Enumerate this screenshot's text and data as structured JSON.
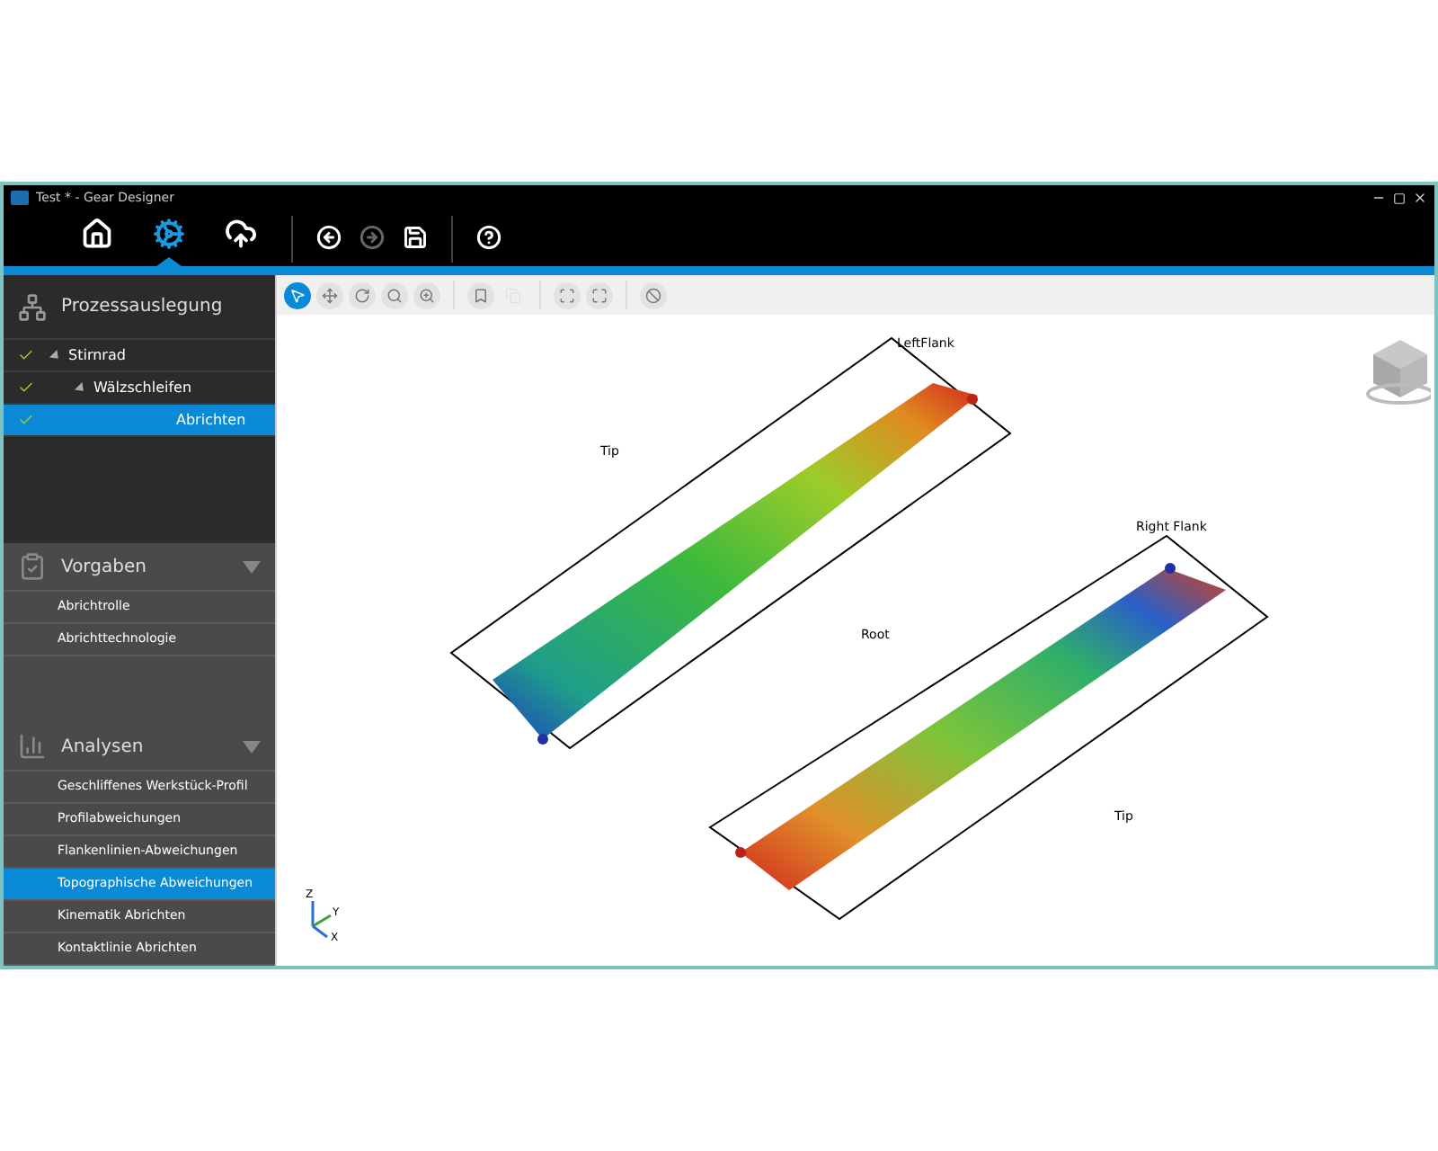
{
  "window": {
    "title": "Test * - Gear Designer"
  },
  "main_toolbar": [
    {
      "kind": "home",
      "selected": false
    },
    {
      "kind": "settings",
      "selected": true
    },
    {
      "kind": "upload",
      "selected": false
    },
    {
      "kind": "undo",
      "disabled": false
    },
    {
      "kind": "redo",
      "disabled": true
    },
    {
      "kind": "save",
      "disabled": false
    },
    {
      "kind": "help",
      "disabled": false
    }
  ],
  "sidebar": {
    "process": {
      "title": "Prozessauslegung",
      "tree": [
        {
          "label": "Stirnrad",
          "checked": true,
          "selected": false,
          "expanded": true,
          "children": [
            {
              "label": "Wälzschleifen",
              "checked": true,
              "selected": false,
              "expanded": true,
              "children": [
                {
                  "label": "Abrichten",
                  "checked": true,
                  "selected": true
                }
              ]
            }
          ]
        }
      ]
    },
    "sections": [
      {
        "kind": "specs",
        "title": "Vorgaben",
        "expanded": true,
        "items": [
          {
            "label": "Abrichtrolle",
            "selected": false
          },
          {
            "label": "Abrichttechnologie",
            "selected": false
          }
        ]
      },
      {
        "kind": "analysis",
        "title": "Analysen",
        "expanded": true,
        "items": [
          {
            "label": "Geschliffenes Werkstück-Profil",
            "selected": false
          },
          {
            "label": "Profilabweichungen",
            "selected": false
          },
          {
            "label": "Flankenlinien-Abweichungen",
            "selected": false
          },
          {
            "label": "Topographische Abweichungen",
            "selected": true
          },
          {
            "label": "Kinematik Abrichten",
            "selected": false
          },
          {
            "label": "Kontaktlinie Abrichten",
            "selected": false
          }
        ]
      }
    ]
  },
  "viewport_toolbar": [
    {
      "kind": "select",
      "selected": true,
      "disabled": false
    },
    {
      "kind": "pan",
      "selected": false,
      "disabled": false
    },
    {
      "kind": "rotate",
      "selected": false,
      "disabled": false
    },
    {
      "kind": "zoom",
      "selected": false,
      "disabled": false
    },
    {
      "kind": "zoom-area",
      "selected": false,
      "disabled": false
    },
    {
      "kind": "bookmark",
      "selected": false,
      "disabled": false
    },
    {
      "kind": "copy",
      "selected": false,
      "disabled": true
    },
    {
      "kind": "fit",
      "selected": false,
      "disabled": false
    },
    {
      "kind": "expand",
      "selected": false,
      "disabled": false
    },
    {
      "kind": "hide",
      "selected": false,
      "disabled": false
    }
  ],
  "viewport": {
    "labels": [
      "LeftFlank",
      "Tip",
      "Root",
      "Right Flank",
      "Tip"
    ],
    "axes": [
      "Z",
      "Y",
      "X"
    ]
  }
}
